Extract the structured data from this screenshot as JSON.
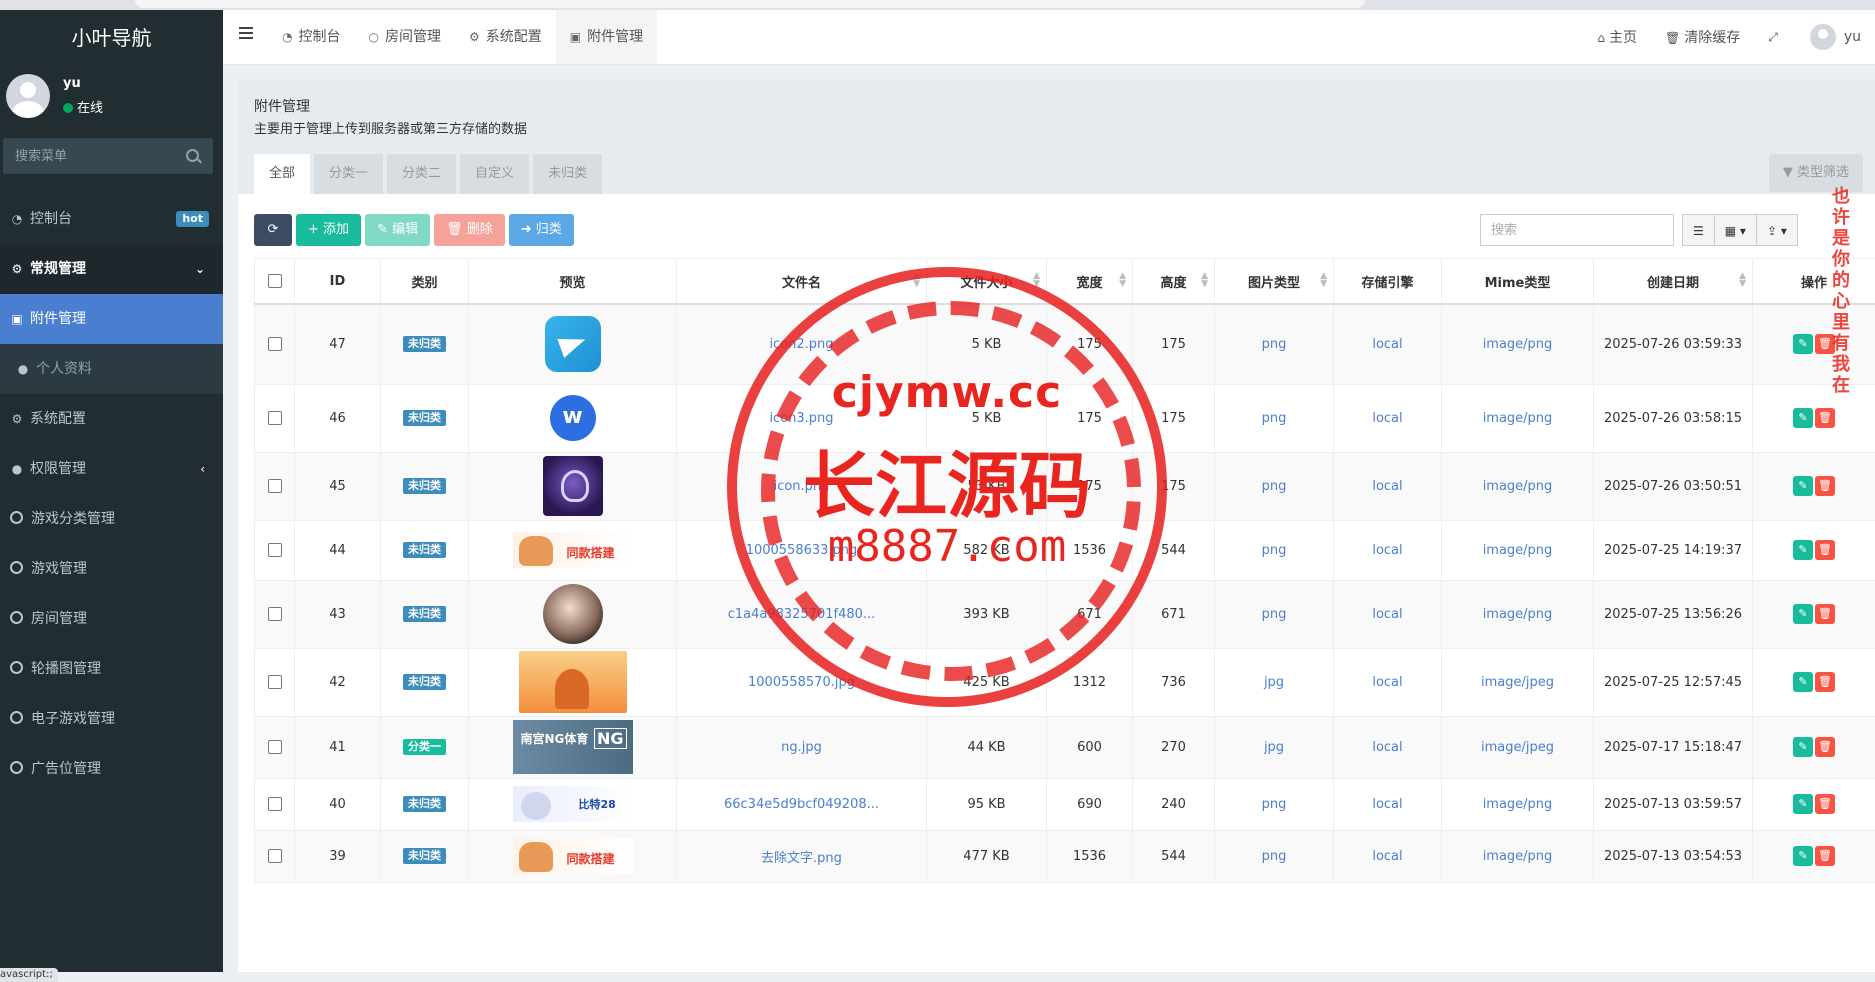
{
  "sidebar": {
    "logo": "小叶导航",
    "user": {
      "name": "yu",
      "status": "在线"
    },
    "search_placeholder": "搜索菜单",
    "items": [
      {
        "label": "控制台",
        "badge": "hot",
        "icon": "dashboard-icon"
      },
      {
        "label": "常规管理",
        "icon": "cogs-icon",
        "caret": "⌄"
      },
      {
        "label": "附件管理",
        "icon": "image-icon"
      },
      {
        "label": "个人资料",
        "icon": "user-icon"
      },
      {
        "label": "系统配置",
        "icon": "gear-icon"
      },
      {
        "label": "权限管理",
        "icon": "group-icon",
        "caret": "‹"
      },
      {
        "label": "游戏分类管理",
        "icon": "circle-icon"
      },
      {
        "label": "游戏管理",
        "icon": "circle-icon"
      },
      {
        "label": "房间管理",
        "icon": "circle-icon"
      },
      {
        "label": "轮播图管理",
        "icon": "circle-icon"
      },
      {
        "label": "电子游戏管理",
        "icon": "circle-icon"
      },
      {
        "label": "广告位管理",
        "icon": "circle-icon"
      }
    ],
    "js_tip": "avascript:;"
  },
  "topnav": {
    "tabs": [
      {
        "label": "控制台",
        "icon": "dashboard-icon"
      },
      {
        "label": "房间管理",
        "icon": "circle-icon"
      },
      {
        "label": "系统配置",
        "icon": "gear-icon"
      },
      {
        "label": "附件管理",
        "icon": "image-icon"
      }
    ],
    "right": {
      "home": "主页",
      "clear_cache": "清除缓存",
      "user": "yu"
    }
  },
  "panel": {
    "title": "附件管理",
    "description": "主要用于管理上传到服务器或第三方存储的数据",
    "filter_tabs": [
      "全部",
      "分类一",
      "分类二",
      "自定义",
      "未归类"
    ],
    "type_filter": "类型筛选"
  },
  "toolbar": {
    "add": "添加",
    "edit": "编辑",
    "delete": "删除",
    "classify": "归类",
    "search_placeholder": "搜索"
  },
  "table": {
    "headers": [
      "ID",
      "类别",
      "预览",
      "文件名",
      "文件大小",
      "宽度",
      "高度",
      "图片类型",
      "存储引擎",
      "Mime类型",
      "创建日期",
      "操作"
    ],
    "rows": [
      {
        "id": "47",
        "category": "未归类",
        "cat_color": "blue",
        "preview": "telegram",
        "filename": "icon2.png",
        "size": "5 KB",
        "width": "175",
        "height": "175",
        "img_type": "png",
        "storage": "local",
        "mime": "image/png",
        "created": "2025-07-26 03:59:33"
      },
      {
        "id": "46",
        "category": "未归类",
        "cat_color": "blue",
        "preview": "w",
        "filename": "icon3.png",
        "size": "5 KB",
        "width": "175",
        "height": "175",
        "img_type": "png",
        "storage": "local",
        "mime": "image/png",
        "created": "2025-07-26 03:58:15"
      },
      {
        "id": "45",
        "category": "未归类",
        "cat_color": "blue",
        "preview": "icon",
        "filename": "icon.png",
        "size": "53 KB",
        "width": "175",
        "height": "175",
        "img_type": "png",
        "storage": "local",
        "mime": "image/png",
        "created": "2025-07-26 03:50:51"
      },
      {
        "id": "44",
        "category": "未归类",
        "cat_color": "blue",
        "preview": "banner",
        "filename": "1000558633.png",
        "size": "582 KB",
        "width": "1536",
        "height": "544",
        "img_type": "png",
        "storage": "local",
        "mime": "image/png",
        "created": "2025-07-25 14:19:37"
      },
      {
        "id": "43",
        "category": "未归类",
        "cat_color": "blue",
        "preview": "face",
        "filename": "c1a4a98325701f480...",
        "size": "393 KB",
        "width": "671",
        "height": "671",
        "img_type": "png",
        "storage": "local",
        "mime": "image/png",
        "created": "2025-07-25 13:56:26"
      },
      {
        "id": "42",
        "category": "未归类",
        "cat_color": "blue",
        "preview": "orange",
        "filename": "1000558570.jpg",
        "size": "425 KB",
        "width": "1312",
        "height": "736",
        "img_type": "jpg",
        "storage": "local",
        "mime": "image/jpeg",
        "created": "2025-07-25 12:57:45"
      },
      {
        "id": "41",
        "category": "分类一",
        "cat_color": "green",
        "preview": "ng",
        "filename": "ng.jpg",
        "size": "44 KB",
        "width": "600",
        "height": "270",
        "img_type": "jpg",
        "storage": "local",
        "mime": "image/jpeg",
        "created": "2025-07-17 15:18:47"
      },
      {
        "id": "40",
        "category": "未归类",
        "cat_color": "blue",
        "preview": "bite",
        "filename": "66c34e5d9bcf049208...",
        "size": "95 KB",
        "width": "690",
        "height": "240",
        "img_type": "png",
        "storage": "local",
        "mime": "image/png",
        "created": "2025-07-13 03:59:57"
      },
      {
        "id": "39",
        "category": "未归类",
        "cat_color": "blue",
        "preview": "banner",
        "filename": "去除文字.png",
        "size": "477 KB",
        "width": "1536",
        "height": "544",
        "img_type": "png",
        "storage": "local",
        "mime": "image/png",
        "created": "2025-07-13 03:54:53"
      }
    ],
    "banner_text": "同款搭建",
    "ng_text": "南宫NG体育",
    "ng_badge": "NG",
    "bite_text": "比特28"
  },
  "watermark": {
    "line1": "cjymw.cc",
    "line2": "长江源码",
    "line3": "m8887.com",
    "side": "也许是你的心里有我在"
  }
}
